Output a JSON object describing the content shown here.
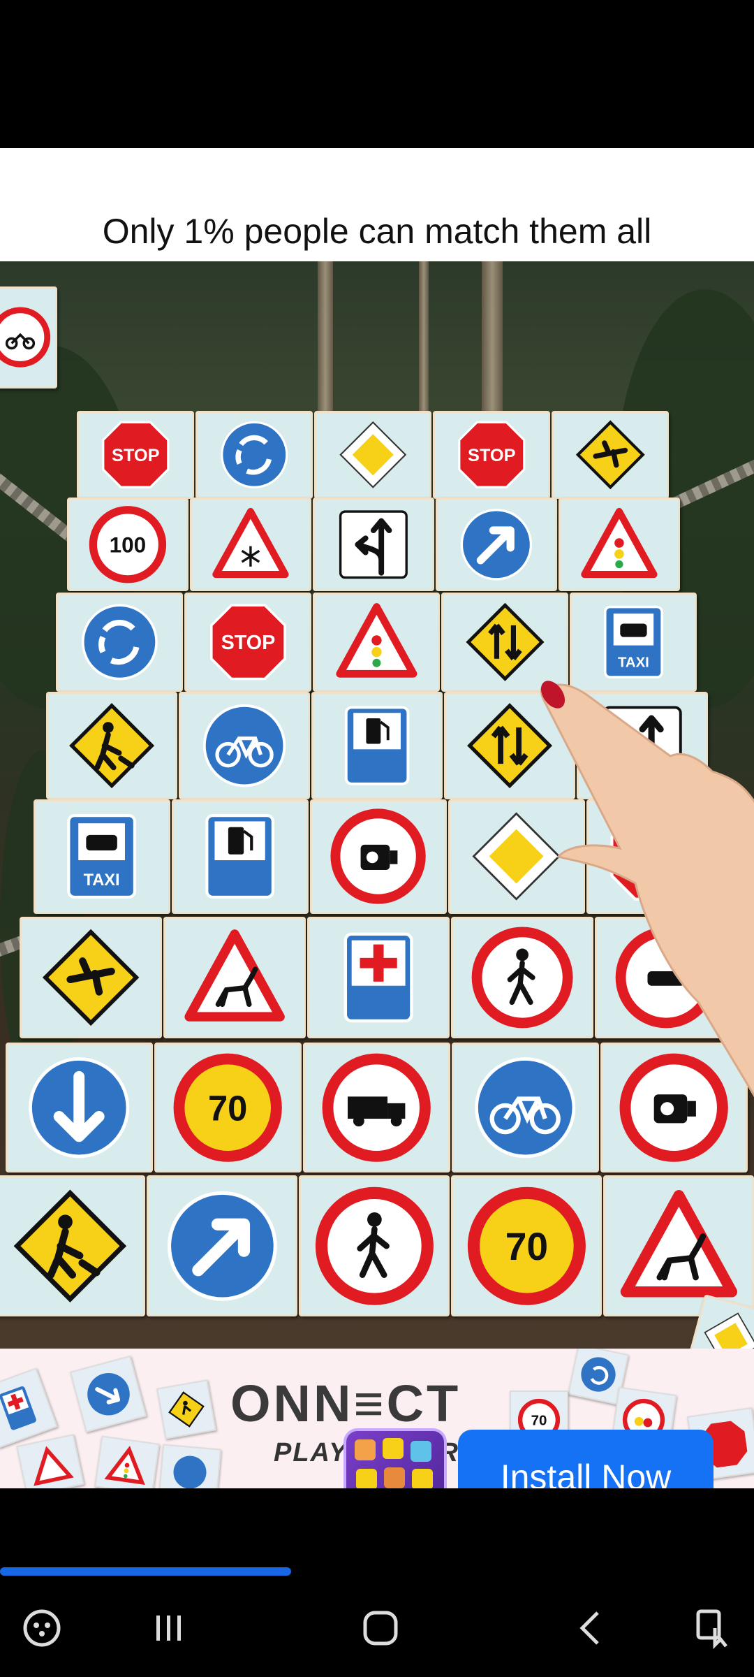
{
  "ad": {
    "headline": "Only 1% people can match them all",
    "logo_text": "ONN≡CT",
    "logo_subtext": "PLAY",
    "logo_subtext_tail": "RE",
    "install_label": "Install Now",
    "progress_fraction": 0.386
  },
  "tiles_text": {
    "stop": "STOP",
    "taxi": "TAXI",
    "speed100": "100",
    "speed70": "70",
    "partial_s": "S"
  },
  "board": {
    "rows": [
      [
        "stop-sign-icon",
        "roundabout-icon",
        "priority-road-icon",
        "stop-sign-icon",
        "airport-icon"
      ],
      [
        "speed-limit-100-icon",
        "snow-warning-icon",
        "lane-turn-icon",
        "direction-arrow-icon",
        "traffic-light-warning-icon"
      ],
      [
        "roundabout-icon",
        "stop-sign-icon",
        "traffic-light-warning-icon",
        "two-way-traffic-icon",
        "taxi-icon"
      ],
      [
        "road-works-icon",
        "bicycle-icon",
        "fuel-station-icon",
        "two-way-traffic-icon",
        "lane-turn-icon"
      ],
      [
        "taxi-icon",
        "fuel-station-icon",
        "speed-camera-icon",
        "priority-road-icon",
        "stop-sign-icon"
      ],
      [
        "airport-icon",
        "deer-warning-icon",
        "hospital-icon",
        "no-pedestrians-icon",
        "no-cars-icon"
      ],
      [
        "down-arrow-icon",
        "speed-limit-70-icon",
        "no-trucks-icon",
        "bicycle-icon",
        "speed-camera-icon"
      ],
      [
        "road-works-icon",
        "direction-arrow-icon",
        "no-pedestrians-icon",
        "speed-limit-70-icon",
        "deer-warning-icon"
      ]
    ]
  },
  "colors": {
    "accent_blue": "#1572f5",
    "sign_red": "#e11b22",
    "sign_blue": "#2f73c5",
    "sign_yellow": "#f7d117"
  },
  "nav": [
    "game-launcher-icon",
    "recent-apps-icon",
    "home-icon",
    "back-icon",
    "screen-assist-icon"
  ]
}
